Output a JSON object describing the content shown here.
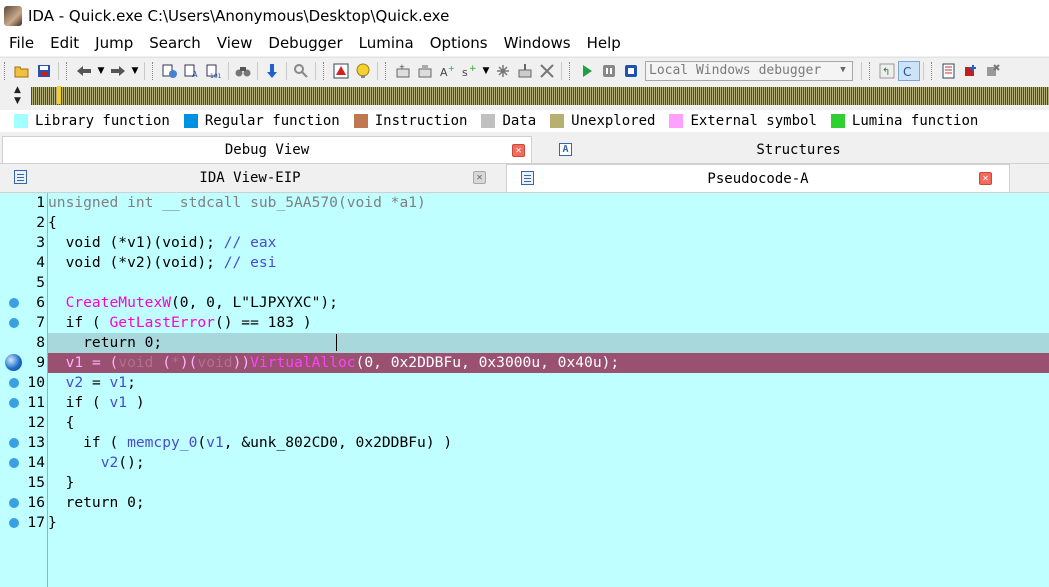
{
  "window": {
    "title": "IDA - Quick.exe C:\\Users\\Anonymous\\Desktop\\Quick.exe"
  },
  "menu": [
    "File",
    "Edit",
    "Jump",
    "Search",
    "View",
    "Debugger",
    "Lumina",
    "Options",
    "Windows",
    "Help"
  ],
  "toolbar": {
    "debugger_select": "Local Windows debugger"
  },
  "legend": [
    {
      "label": "Library function",
      "color": "#a0ffff"
    },
    {
      "label": "Regular function",
      "color": "#0090e0"
    },
    {
      "label": "Instruction",
      "color": "#c07850"
    },
    {
      "label": "Data",
      "color": "#c0c0c0"
    },
    {
      "label": "Unexplored",
      "color": "#b8b070"
    },
    {
      "label": "External symbol",
      "color": "#ffa0ff"
    },
    {
      "label": "Lumina function",
      "color": "#30d030"
    }
  ],
  "tabs_top": [
    {
      "label": "Debug View"
    },
    {
      "label": "Structures"
    }
  ],
  "tabs_bottom": [
    {
      "label": "IDA View-EIP"
    },
    {
      "label": "Pseudocode-A"
    }
  ],
  "code": {
    "line_numbers": [
      "1",
      "2",
      "3",
      "4",
      "5",
      "6",
      "7",
      "8",
      "9",
      "10",
      "11",
      "12",
      "13",
      "14",
      "15",
      "16",
      "17"
    ],
    "l1": {
      "sig": "unsigned int __stdcall sub_5AA570(",
      "params": "void *a1",
      ")": ")"
    },
    "l2": "{",
    "l3": {
      "decl": "  void (*v1)(void); ",
      "comment": "// eax"
    },
    "l4": {
      "decl": "  void (*v2)(void); ",
      "comment": "// esi"
    },
    "l6": {
      "indent": "  ",
      "fn": "CreateMutexW",
      "args": "(0, 0, L\"LJPXYXC\");"
    },
    "l7": {
      "pre": "  if ( ",
      "fn": "GetLastError",
      "post": "() == 183 )"
    },
    "l8": "    return 0;",
    "l9": {
      "indent": "  ",
      "v1": "v1",
      "eq": " = (",
      "cast1": "void",
      " ": " (",
      "star": "*",
      "cast2": ")(",
      "void": "void",
      "close": "))",
      "fn": "VirtualAlloc",
      "args": "(0, 0x2DDBFu, 0x3000u, 0x40u);"
    },
    "l10": {
      "indent": "  ",
      "v2": "v2",
      "eq": " = ",
      "v1": "v1",
      ";": ";"
    },
    "l11": {
      "pre": "  if ( ",
      "v1": "v1",
      "post": " )"
    },
    "l12": "  {",
    "l13": {
      "pre": "    if ( ",
      "fn": "memcpy_0",
      "open": "(",
      "v1": "v1",
      "post": ", &unk_802CD0, 0x2DDBFu) )"
    },
    "l14": {
      "indent": "      ",
      "v2": "v2",
      "post": "();"
    },
    "l15": "  }",
    "l16": "  return 0;",
    "l17": "}"
  }
}
